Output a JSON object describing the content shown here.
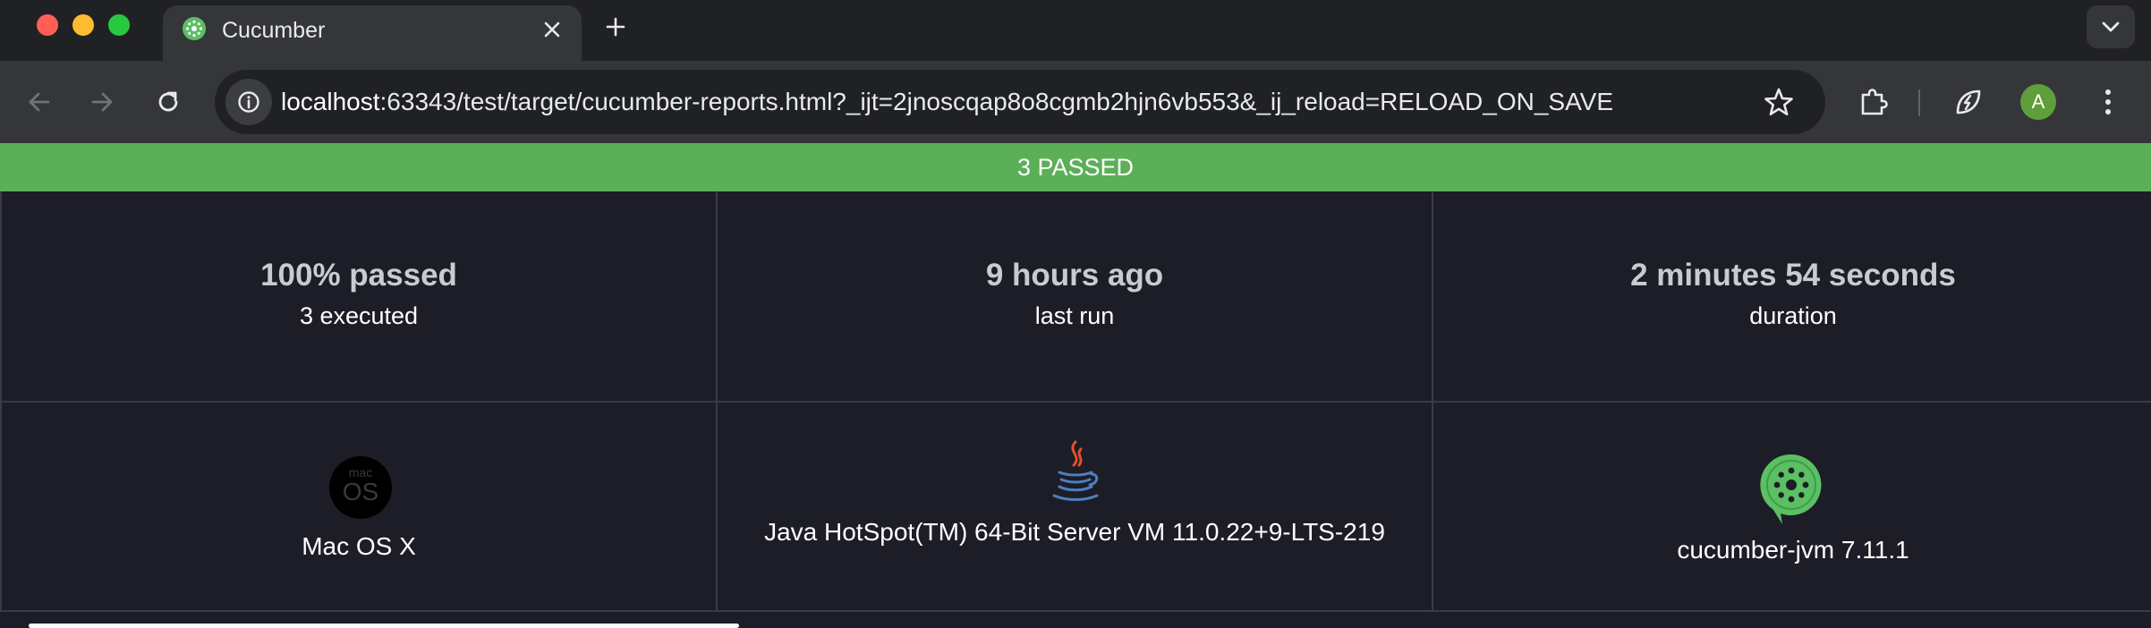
{
  "browser": {
    "tab": {
      "title": "Cucumber",
      "favicon": "cucumber-favicon"
    },
    "address": {
      "host": "localhost",
      "rest": ":63343/test/target/cucumber-reports.html?_ijt=2jnoscqap8o8cgmb2hjn6vb553&_ij_reload=RELOAD_ON_SAVE"
    },
    "avatar_letter": "A",
    "icons": {
      "back": "arrow-left-icon",
      "forward": "arrow-right-icon",
      "reload": "reload-icon",
      "site_info": "info-icon",
      "bookmark": "star-icon",
      "extensions": "puzzle-icon",
      "performance": "leaf-bolt-icon",
      "menu": "kebab-icon"
    }
  },
  "report": {
    "status_banner": "3 PASSED",
    "status_color": "#5baf57",
    "stats": [
      {
        "main": "100% passed",
        "sub": "3 executed"
      },
      {
        "main": "9 hours ago",
        "sub": "last run"
      },
      {
        "main": "2 minutes 54 seconds",
        "sub": "duration"
      }
    ],
    "environment": [
      {
        "label": "Mac OS X",
        "logo": "macos-logo",
        "logo_text_small": "mac",
        "logo_text_large": "OS"
      },
      {
        "label": "Java HotSpot(TM) 64-Bit Server VM 11.0.22+9-LTS-219",
        "logo": "java-logo"
      },
      {
        "label": "cucumber-jvm 7.11.1",
        "logo": "cucumber-logo"
      }
    ]
  }
}
